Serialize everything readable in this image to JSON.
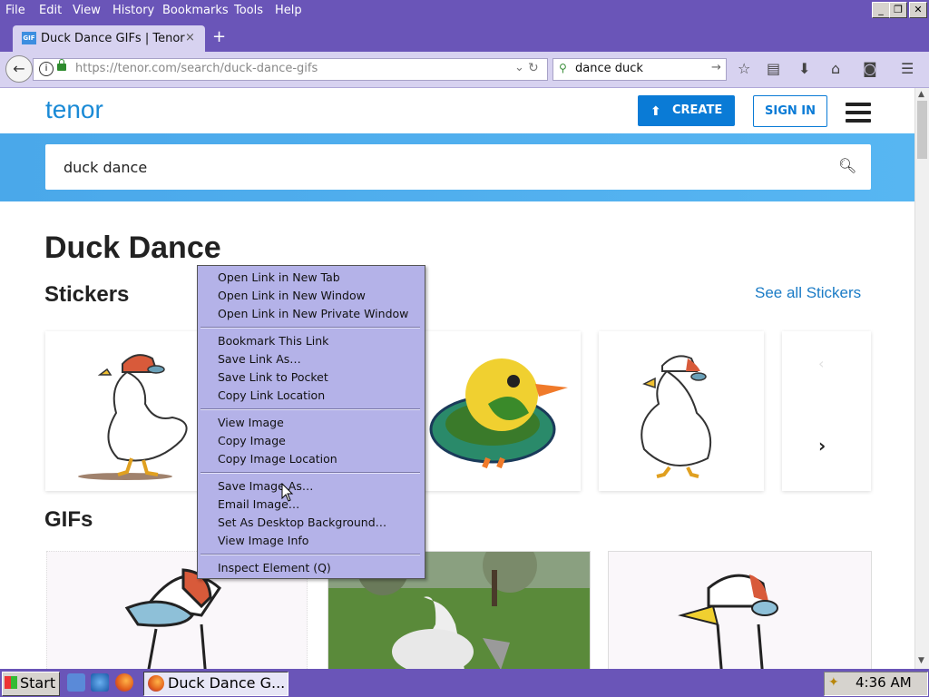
{
  "menubar": {
    "items": [
      "File",
      "Edit",
      "View",
      "History",
      "Bookmarks",
      "Tools",
      "Help"
    ]
  },
  "tab": {
    "favicon": "GIF",
    "title": "Duck Dance GIFs | Tenor",
    "close": "×",
    "new_tab": "+"
  },
  "navbar": {
    "url": "https://tenor.com/search/duck-dance-gifs",
    "search_value": "dance duck"
  },
  "page": {
    "logo": "tenor",
    "create_label": "CREATE",
    "signin_label": "SIGN IN",
    "search_value": "duck dance",
    "heading": "Duck Dance",
    "stickers_heading": "Stickers",
    "see_all": "See all Stickers",
    "gifs_heading": "GIFs"
  },
  "context_menu": {
    "items": [
      "Open Link in New Tab",
      "Open Link in New Window",
      "Open Link in New Private Window",
      "Bookmark This Link",
      "Save Link As…",
      "Save Link to Pocket",
      "Copy Link Location",
      "View Image",
      "Copy Image",
      "Copy Image Location",
      "Save Image As…",
      "Email Image…",
      "Set As Desktop Background…",
      "View Image Info",
      "Inspect Element (Q)"
    ]
  },
  "taskbar": {
    "start": "Start",
    "task_title": "Duck Dance G...",
    "time": "4:36 AM"
  },
  "colors": {
    "titlebar": "#6a55b8",
    "tenor_blue": "#0a7bd6",
    "banner": "#4aa8ea",
    "context_menu": "#b4b2e8"
  }
}
